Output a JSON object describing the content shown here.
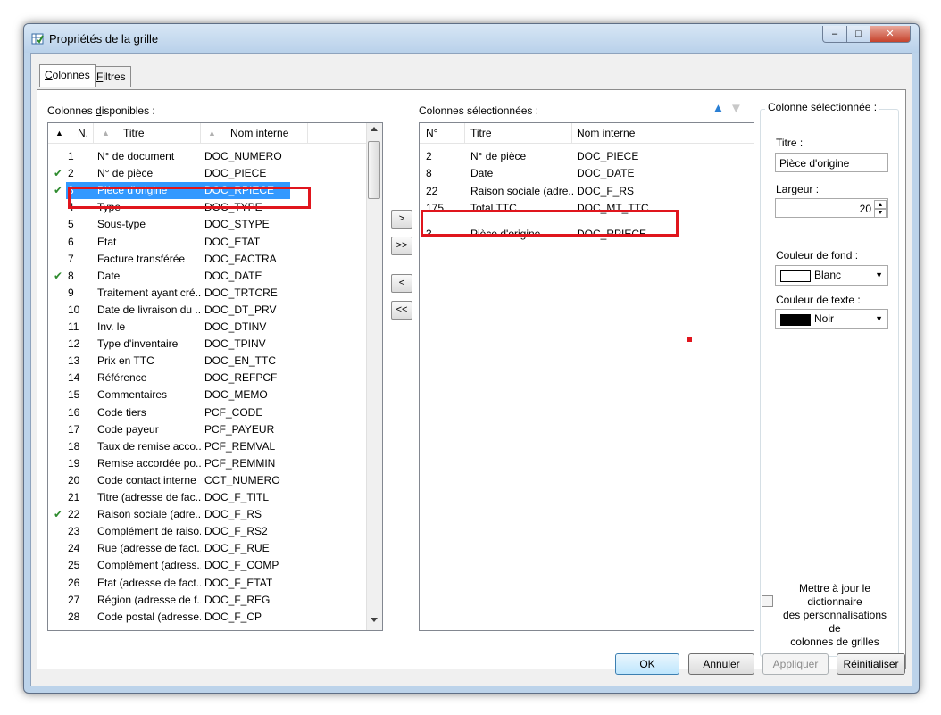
{
  "window": {
    "title": "Propriétés de la grille",
    "controls": {
      "minimize": "–",
      "maximize": "□",
      "close": "✕"
    }
  },
  "tabs": [
    {
      "label": "Colonnes",
      "hotkey": "C",
      "rest": "olonnes"
    },
    {
      "label": "Filtres",
      "hotkey": "F",
      "rest": "iltres"
    }
  ],
  "available": {
    "label_prefix": "Colonnes ",
    "label_hotkey": "d",
    "label_rest": "isponibles :",
    "headers": {
      "num": "N.",
      "title": "Titre",
      "internal": "Nom interne"
    },
    "sort_icons": {
      "num": "▲",
      "title": "▲",
      "internal": "▲"
    },
    "rows": [
      {
        "check": "",
        "num": "1",
        "title": "N° de document",
        "internal": "DOC_NUMERO"
      },
      {
        "check": "✔",
        "num": "2",
        "title": "N° de pièce",
        "internal": "DOC_PIECE"
      },
      {
        "check": "✔",
        "num": "3",
        "title": "Pièce d'origine",
        "internal": "DOC_RPIECE"
      },
      {
        "check": "",
        "num": "4",
        "title": "Type",
        "internal": "DOC_TYPE"
      },
      {
        "check": "",
        "num": "5",
        "title": "Sous-type",
        "internal": "DOC_STYPE"
      },
      {
        "check": "",
        "num": "6",
        "title": "Etat",
        "internal": "DOC_ETAT"
      },
      {
        "check": "",
        "num": "7",
        "title": "Facture transférée",
        "internal": "DOC_FACTRA"
      },
      {
        "check": "✔",
        "num": "8",
        "title": "Date",
        "internal": "DOC_DATE"
      },
      {
        "check": "",
        "num": "9",
        "title": "Traitement ayant cré...",
        "internal": "DOC_TRTCRE"
      },
      {
        "check": "",
        "num": "10",
        "title": "Date de livraison du ...",
        "internal": "DOC_DT_PRV"
      },
      {
        "check": "",
        "num": "11",
        "title": "Inv. le",
        "internal": "DOC_DTINV"
      },
      {
        "check": "",
        "num": "12",
        "title": "Type d'inventaire",
        "internal": "DOC_TPINV"
      },
      {
        "check": "",
        "num": "13",
        "title": "Prix en TTC",
        "internal": "DOC_EN_TTC"
      },
      {
        "check": "",
        "num": "14",
        "title": "Référence",
        "internal": "DOC_REFPCF"
      },
      {
        "check": "",
        "num": "15",
        "title": "Commentaires",
        "internal": "DOC_MEMO"
      },
      {
        "check": "",
        "num": "16",
        "title": "Code tiers",
        "internal": "PCF_CODE"
      },
      {
        "check": "",
        "num": "17",
        "title": "Code payeur",
        "internal": "PCF_PAYEUR"
      },
      {
        "check": "",
        "num": "18",
        "title": "Taux de remise acco...",
        "internal": "PCF_REMVAL"
      },
      {
        "check": "",
        "num": "19",
        "title": "Remise accordée po...",
        "internal": "PCF_REMMIN"
      },
      {
        "check": "",
        "num": "20",
        "title": "Code contact interne",
        "internal": "CCT_NUMERO"
      },
      {
        "check": "",
        "num": "21",
        "title": "Titre (adresse de fac...",
        "internal": "DOC_F_TITL"
      },
      {
        "check": "✔",
        "num": "22",
        "title": "Raison sociale (adre...",
        "internal": "DOC_F_RS"
      },
      {
        "check": "",
        "num": "23",
        "title": "Complément de raiso...",
        "internal": "DOC_F_RS2"
      },
      {
        "check": "",
        "num": "24",
        "title": "Rue (adresse de fact...",
        "internal": "DOC_F_RUE"
      },
      {
        "check": "",
        "num": "25",
        "title": "Complément (adress...",
        "internal": "DOC_F_COMP"
      },
      {
        "check": "",
        "num": "26",
        "title": "Etat (adresse de fact...",
        "internal": "DOC_F_ETAT"
      },
      {
        "check": "",
        "num": "27",
        "title": "Région (adresse de f...",
        "internal": "DOC_F_REG"
      },
      {
        "check": "",
        "num": "28",
        "title": "Code postal (adresse...",
        "internal": "DOC_F_CP"
      }
    ],
    "selected_index": 2
  },
  "move_buttons": {
    "add": ">",
    "add_all": ">>",
    "remove": "<",
    "remove_all": "<<"
  },
  "selected": {
    "label": "Colonnes sélectionnées :",
    "order_up": "▲",
    "order_down": "▼",
    "headers": {
      "num": "N°",
      "title": "Titre",
      "internal": "Nom interne"
    },
    "rows": [
      {
        "num": "2",
        "title": "N° de pièce",
        "internal": "DOC_PIECE"
      },
      {
        "num": "8",
        "title": "Date",
        "internal": "DOC_DATE"
      },
      {
        "num": "22",
        "title": "Raison sociale (adre...",
        "internal": "DOC_F_RS"
      },
      {
        "num": "175",
        "title": "Total TTC",
        "internal": "DOC_MT_TTC"
      },
      {
        "num": "3",
        "title": "Pièce d'origine",
        "internal": "DOC_RPIECE"
      }
    ]
  },
  "properties": {
    "group_label": "Colonne sélectionnée :",
    "title_label": "Titre :",
    "title_value": "Pièce d'origine",
    "width_label": "Largeur :",
    "width_value": "20",
    "bg_label": "Couleur de fond :",
    "bg_value": "Blanc",
    "bg_swatch": "#ffffff",
    "text_label": "Couleur de texte :",
    "text_value": "Noir",
    "text_swatch": "#000000",
    "update_line1": "Mettre à jour le dictionnaire",
    "update_line2": "des personnalisations de",
    "update_line3": "colonnes de grilles",
    "update_checked": false
  },
  "footer": {
    "ok": "OK",
    "cancel": "Annuler",
    "apply": "Appliquer",
    "reset": "Réinitialiser"
  },
  "colors": {
    "selection": "#3399ff",
    "highlight_box": "#e0151d",
    "check": "#2e8b2e"
  }
}
